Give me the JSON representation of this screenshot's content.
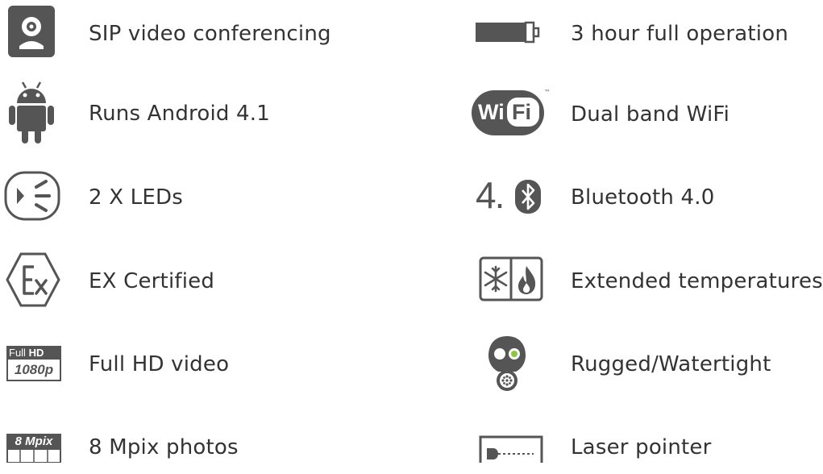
{
  "features_left": [
    {
      "label": "SIP video conferencing",
      "icon": "webcam-icon"
    },
    {
      "label": "Runs Android 4.1",
      "icon": "android-icon"
    },
    {
      "label": "2 X LEDs",
      "icon": "led-icon"
    },
    {
      "label": "EX Certified",
      "icon": "ex-certified-icon"
    },
    {
      "label": "Full HD video",
      "icon": "full-hd-icon",
      "badge_top_a": "Full",
      "badge_top_b": "HD",
      "badge_bottom": "1080p"
    },
    {
      "label": "8 Mpix photos",
      "icon": "camera-8mpix-icon",
      "badge": "8 Mpix"
    }
  ],
  "features_right": [
    {
      "label": "3 hour full operation",
      "icon": "battery-icon"
    },
    {
      "label": "Dual band WiFi",
      "icon": "wifi-logo-icon",
      "logo_a": "Wi",
      "logo_b": "Fi",
      "tm": "™"
    },
    {
      "label": "Bluetooth 4.0",
      "icon": "bluetooth-icon",
      "version": "4."
    },
    {
      "label": "Extended temperatures",
      "icon": "temperature-icon"
    },
    {
      "label": "Rugged/Watertight",
      "icon": "gas-mask-icon"
    },
    {
      "label": "Laser pointer",
      "icon": "laser-pointer-icon"
    }
  ],
  "colors": {
    "icon": "#555555",
    "text": "#333333",
    "accent_green": "#8dc63f"
  }
}
